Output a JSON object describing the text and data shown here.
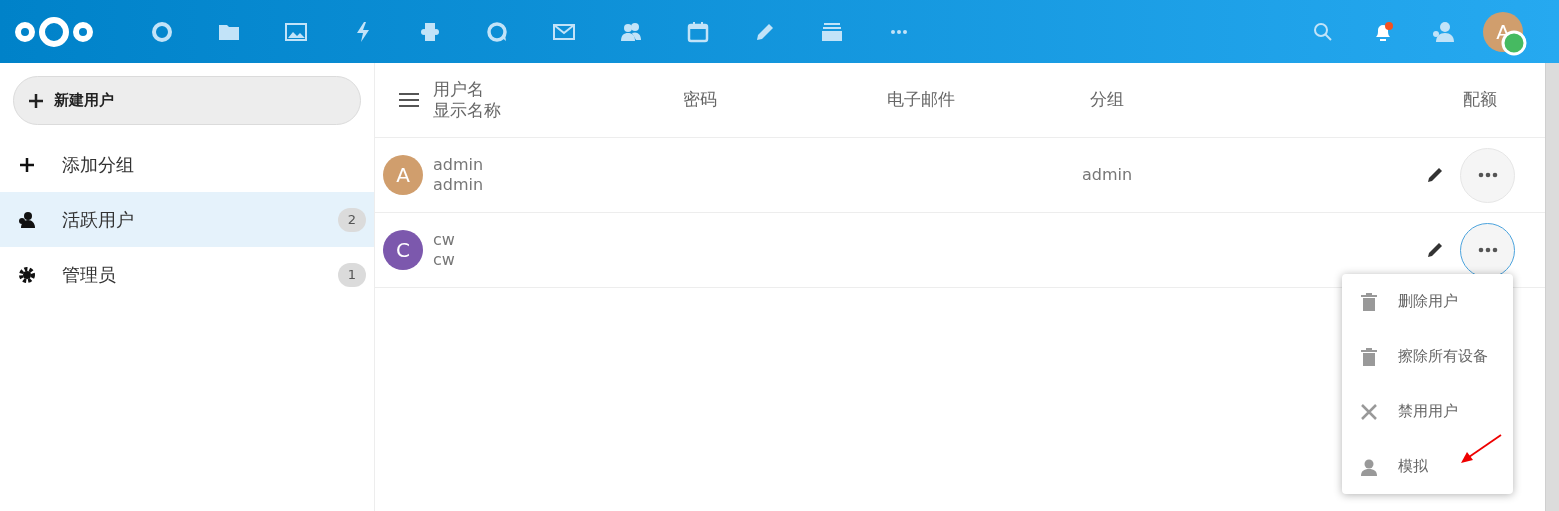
{
  "sidebar": {
    "new_user_button": "新建用户",
    "items": [
      {
        "kind": "add",
        "label": "添加分组",
        "selected": false
      },
      {
        "kind": "group",
        "label": "活跃用户",
        "count": "2",
        "selected": true
      },
      {
        "kind": "admin",
        "label": "管理员",
        "count": "1",
        "selected": false
      }
    ]
  },
  "table": {
    "columns": {
      "username": "用户名",
      "display_name": "显示名称",
      "password": "密码",
      "email": "电子邮件",
      "groups": "分组",
      "quota": "配额"
    },
    "rows": [
      {
        "initial": "A",
        "color": "#d09e6d",
        "username": "admin",
        "display_name": "admin",
        "groups": "admin",
        "menu_open": false
      },
      {
        "initial": "C",
        "color": "#7c58ad",
        "username": "cw",
        "display_name": "cw",
        "groups": "",
        "menu_open": true
      }
    ]
  },
  "action_menu": {
    "items": [
      {
        "kind": "delete",
        "label": "删除用户"
      },
      {
        "kind": "delete",
        "label": "擦除所有设备"
      },
      {
        "kind": "disable",
        "label": "禁用用户"
      },
      {
        "kind": "impersonate",
        "label": "模拟"
      }
    ]
  },
  "user_avatar": {
    "initial": "A",
    "color": "#d09e6d"
  }
}
